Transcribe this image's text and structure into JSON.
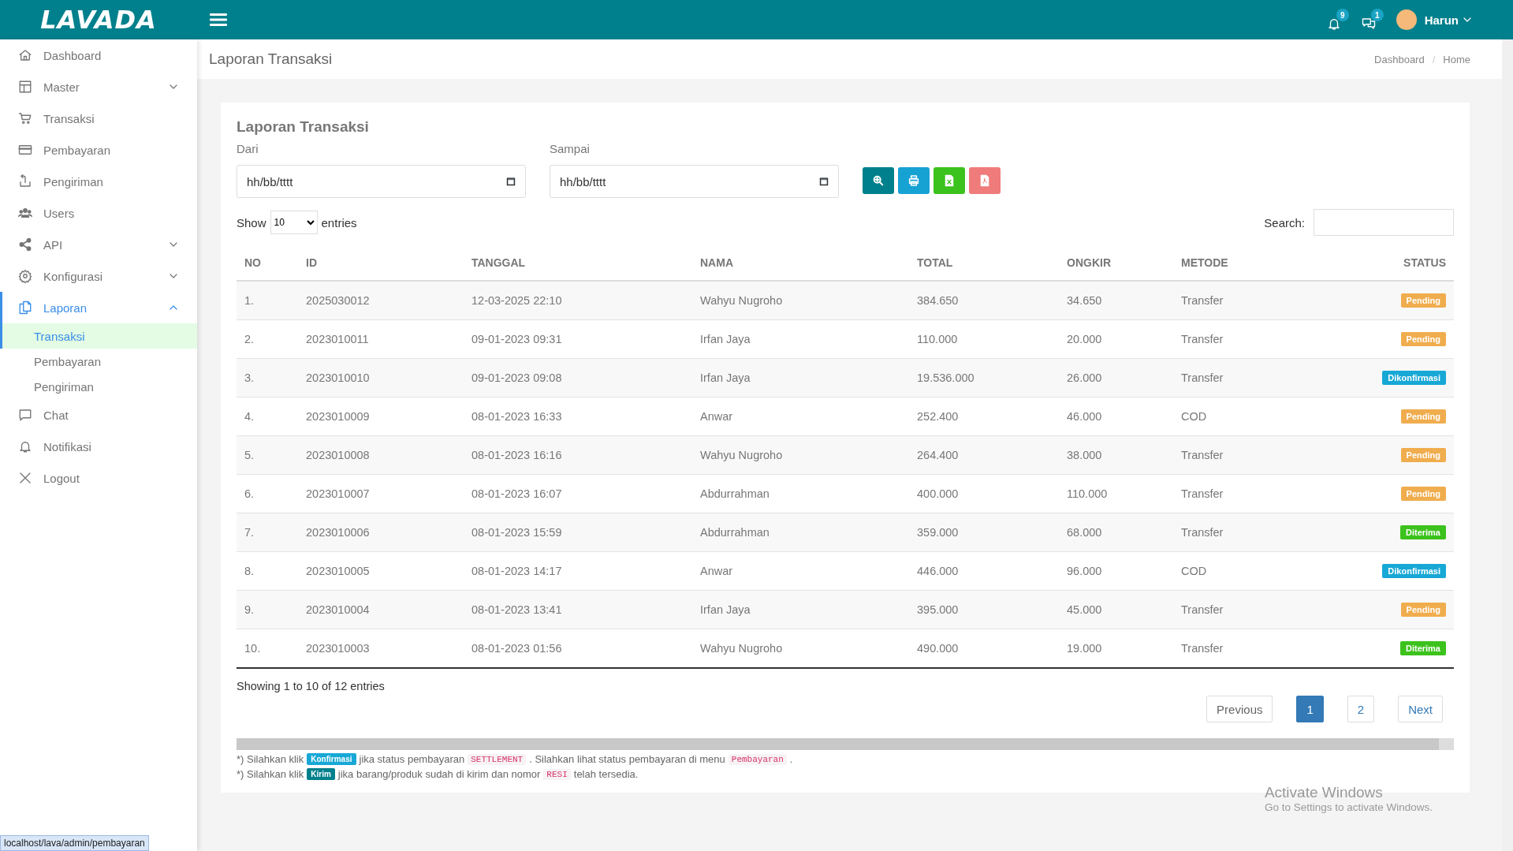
{
  "topbar": {
    "logo": "LAVADA",
    "notifications": {
      "count": "9"
    },
    "messages": {
      "count": "1"
    },
    "user": {
      "name": "Harun"
    }
  },
  "sidebar": {
    "items": [
      {
        "label": "Dashboard",
        "selected": false
      },
      {
        "label": "Master",
        "selected": false,
        "expanded": false
      },
      {
        "label": "Transaksi",
        "selected": false
      },
      {
        "label": "Pembayaran",
        "selected": false
      },
      {
        "label": "Pengiriman",
        "selected": false
      },
      {
        "label": "Users",
        "selected": false
      },
      {
        "label": "API",
        "selected": false,
        "expanded": false
      },
      {
        "label": "Konfigurasi",
        "selected": false,
        "expanded": false
      },
      {
        "label": "Laporan",
        "selected": true,
        "expanded": true,
        "children": [
          {
            "label": "Transaksi",
            "selected": true
          },
          {
            "label": "Pembayaran",
            "selected": false
          },
          {
            "label": "Pengiriman",
            "selected": false
          }
        ]
      },
      {
        "label": "Chat",
        "selected": false
      },
      {
        "label": "Notifikasi",
        "selected": false
      },
      {
        "label": "Logout",
        "selected": false
      }
    ]
  },
  "page_header": {
    "title": "Laporan Transaksi",
    "breadcrumb": {
      "items": [
        "Dashboard",
        "Home"
      ],
      "separator": "/"
    }
  },
  "card": {
    "title": "Laporan Transaksi",
    "filters": [
      {
        "label": "Dari",
        "placeholder": "hh/bb/tttt"
      },
      {
        "label": "Sampai",
        "placeholder": "hh/bb/tttt"
      }
    ],
    "actions": [
      {
        "kind": "search",
        "color": "#00808c"
      },
      {
        "kind": "print",
        "color": "#17a2d4"
      },
      {
        "kind": "excel",
        "color": "#3cc21c"
      },
      {
        "kind": "pdf",
        "color": "#ef7b7b"
      }
    ],
    "length": {
      "before": "Show",
      "value": "10",
      "after": "entries"
    },
    "search": {
      "label": "Search:"
    },
    "table": {
      "columns": [
        "NO",
        "ID",
        "TANGGAL",
        "NAMA",
        "TOTAL",
        "ONGKIR",
        "METODE",
        "STATUS"
      ],
      "rows": [
        {
          "cells": [
            "1.",
            "2025030012",
            "12-03-2025 22:10",
            "Wahyu Nugroho",
            "384.650",
            "34.650",
            "Transfer"
          ],
          "status": {
            "label": "Pending",
            "color": "#f0ad4e"
          }
        },
        {
          "cells": [
            "2.",
            "2023010011",
            "09-01-2023 09:31",
            "Irfan Jaya",
            "110.000",
            "20.000",
            "Transfer"
          ],
          "status": {
            "label": "Pending",
            "color": "#f0ad4e"
          }
        },
        {
          "cells": [
            "3.",
            "2023010010",
            "09-01-2023 09:08",
            "Irfan Jaya",
            "19.536.000",
            "26.000",
            "Transfer"
          ],
          "status": {
            "label": "Dikonfirmasi",
            "color": "#17a8d6"
          }
        },
        {
          "cells": [
            "4.",
            "2023010009",
            "08-01-2023 16:33",
            "Anwar",
            "252.400",
            "46.000",
            "COD"
          ],
          "status": {
            "label": "Pending",
            "color": "#f0ad4e"
          }
        },
        {
          "cells": [
            "5.",
            "2023010008",
            "08-01-2023 16:16",
            "Wahyu Nugroho",
            "264.400",
            "38.000",
            "Transfer"
          ],
          "status": {
            "label": "Pending",
            "color": "#f0ad4e"
          }
        },
        {
          "cells": [
            "6.",
            "2023010007",
            "08-01-2023 16:07",
            "Abdurrahman",
            "400.000",
            "110.000",
            "Transfer"
          ],
          "status": {
            "label": "Pending",
            "color": "#f0ad4e"
          }
        },
        {
          "cells": [
            "7.",
            "2023010006",
            "08-01-2023 15:59",
            "Abdurrahman",
            "359.000",
            "68.000",
            "Transfer"
          ],
          "status": {
            "label": "Diterima",
            "color": "#3cc21c"
          }
        },
        {
          "cells": [
            "8.",
            "2023010005",
            "08-01-2023 14:17",
            "Anwar",
            "446.000",
            "96.000",
            "COD"
          ],
          "status": {
            "label": "Dikonfirmasi",
            "color": "#17a8d6"
          }
        },
        {
          "cells": [
            "9.",
            "2023010004",
            "08-01-2023 13:41",
            "Irfan Jaya",
            "395.000",
            "45.000",
            "Transfer"
          ],
          "status": {
            "label": "Pending",
            "color": "#f0ad4e"
          }
        },
        {
          "cells": [
            "10.",
            "2023010003",
            "08-01-2023 01:56",
            "Wahyu Nugroho",
            "490.000",
            "19.000",
            "Transfer"
          ],
          "status": {
            "label": "Diterima",
            "color": "#3cc21c"
          }
        }
      ]
    },
    "info": "Showing 1 to 10 of 12 entries",
    "pagination": [
      {
        "kind": "prev",
        "label": "Previous",
        "selected": false
      },
      {
        "kind": "page",
        "label": "1",
        "selected": true
      },
      {
        "kind": "page",
        "label": "2",
        "selected": false
      },
      {
        "kind": "next",
        "label": "Next",
        "selected": false
      }
    ],
    "notes": [
      [
        {
          "kind": "text",
          "text": "*) Silahkan klik"
        },
        {
          "kind": "badge",
          "text": "Konfirmasi",
          "color": "#17a8d6"
        },
        {
          "kind": "text",
          "text": "jika status pembayaran"
        },
        {
          "kind": "code",
          "text": "SETTLEMENT"
        },
        {
          "kind": "text",
          "text": ". Silahkan lihat status pembayaran di menu"
        },
        {
          "kind": "code",
          "text": "Pembayaran"
        },
        {
          "kind": "text",
          "text": "."
        }
      ],
      [
        {
          "kind": "text",
          "text": "*) Silahkan klik"
        },
        {
          "kind": "badge",
          "text": "Kirim",
          "color": "#00808c"
        },
        {
          "kind": "text",
          "text": "jika barang/produk sudah di kirim dan nomor"
        },
        {
          "kind": "code",
          "text": "RESI"
        },
        {
          "kind": "text",
          "text": "telah tersedia."
        }
      ]
    ]
  },
  "os_notice": {
    "title": "Activate Windows",
    "text": "Go to Settings to activate Windows."
  },
  "status_url": "localhost/lava/admin/pembayaran"
}
